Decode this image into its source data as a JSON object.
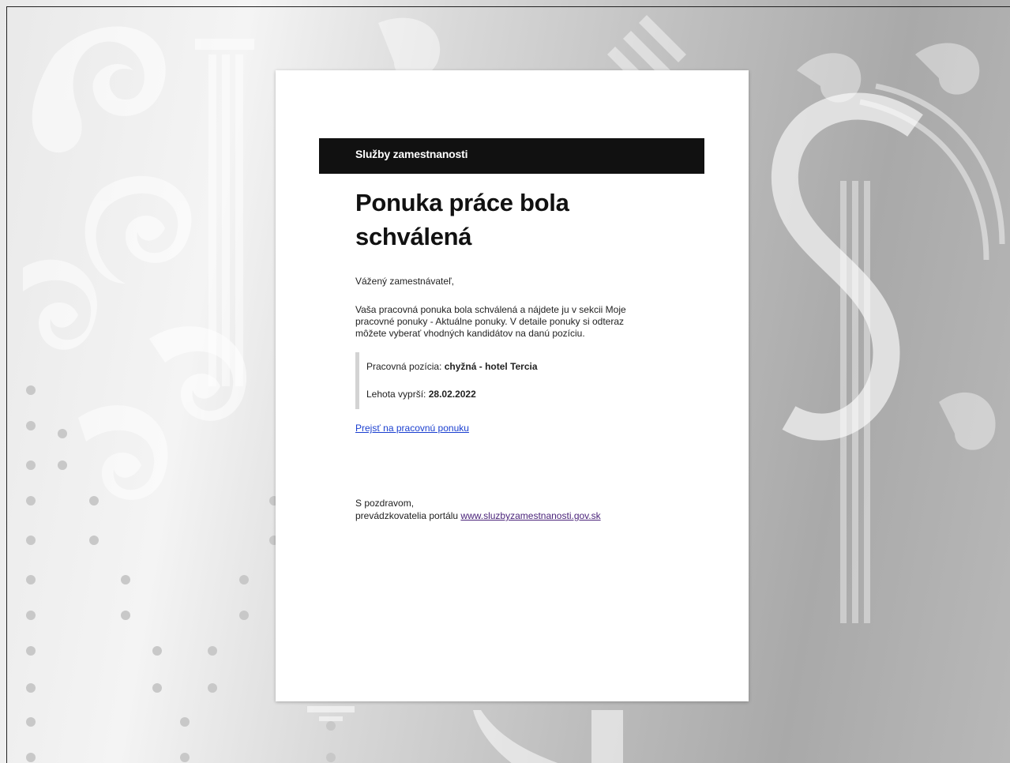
{
  "email": {
    "brand": "Služby zamestnanosti",
    "title": "Ponuka práce bola schválená",
    "greeting": "Vážený zamestnávateľ,",
    "body": "Vaša pracovná ponuka bola schválená a nájdete ju v sekcii Moje pracovné ponuky - Aktuálne ponuky. V detaile ponuky si odteraz môžete vyberať vhodných kandidátov na danú pozíciu.",
    "position_label": "Pracovná pozícia: ",
    "position_value": "chyžná - hotel Tercia",
    "deadline_label": "Lehota vyprší: ",
    "deadline_value": "28.02.2022",
    "cta_link": "Prejsť na pracovnú ponuku",
    "signoff_line1": "S pozdravom,",
    "signoff_line2": "prevádzkovatelia portálu ",
    "site_link": "www.sluzbyzamestnanosti.gov.sk"
  },
  "colors": {
    "header_bg": "#111111",
    "link": "#1a3fd0",
    "visited_link": "#4a237a"
  }
}
